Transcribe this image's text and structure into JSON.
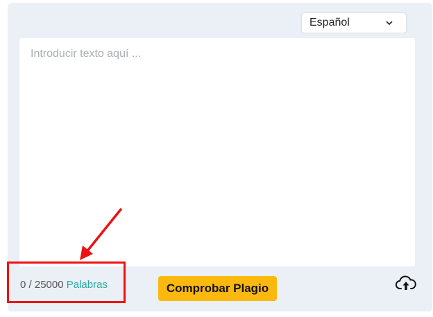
{
  "language_selector": {
    "selected": "Español",
    "icon": "chevron-down-icon"
  },
  "editor": {
    "placeholder": "Introducir texto aquí ...",
    "value": ""
  },
  "word_counter": {
    "current": "0",
    "separator": "/",
    "limit": "25000",
    "unit_label": "Palabras"
  },
  "actions": {
    "check_label": "Comprobar Plagio",
    "upload_icon": "cloud-upload-icon"
  },
  "annotation": {
    "highlight_color": "#ee1111",
    "arrow_icon": "red-arrow-icon"
  },
  "colors": {
    "panel_bg": "#eaf0f5",
    "button_bg": "#fbb910",
    "unit_color": "#2aa8a0"
  }
}
